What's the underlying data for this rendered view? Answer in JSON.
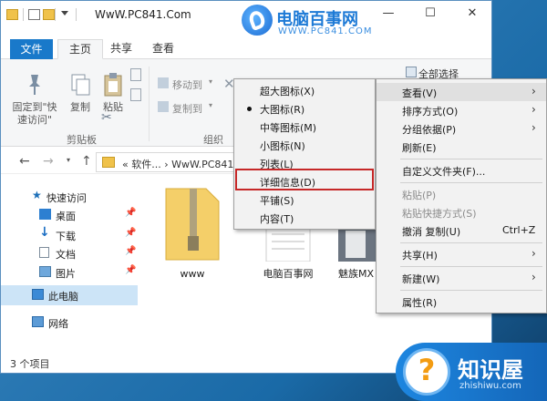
{
  "window": {
    "title": "WwW.PC841.Com",
    "controls": {
      "minimize": "—",
      "maximize": "☐",
      "close": "✕"
    }
  },
  "watermark_logo": {
    "title": "电脑百事网",
    "url": "WWW.PC841.COM"
  },
  "ribbon_tabs": {
    "file": "文件",
    "home": "主页",
    "share": "共享",
    "view": "查看"
  },
  "ribbon": {
    "pin_label": "固定到\"快\n速访问\"",
    "copy_label": "复制",
    "paste_label": "粘贴",
    "move_to": "移动到",
    "copy_to": "复制到",
    "clipboard_group": "剪贴板",
    "organize_group": "组织",
    "select_all": "全部选择"
  },
  "address": {
    "path": "«  软件...  ›  WwW.PC841 ›",
    "back": "←",
    "forward": "→",
    "up": "↑"
  },
  "nav": {
    "quick_access": "快速访问",
    "desktop": "桌面",
    "downloads": "下载",
    "documents": "文档",
    "pictures": "图片",
    "this_pc": "此电脑",
    "network": "网络",
    "pin": "📌"
  },
  "files": [
    {
      "name": "www"
    },
    {
      "name": "电脑百事网"
    },
    {
      "name": "魅族MX"
    }
  ],
  "status": {
    "count": "3 个项目"
  },
  "view_submenu": [
    {
      "label": "超大图标(X)"
    },
    {
      "label": "大图标(R)",
      "selected": true
    },
    {
      "label": "中等图标(M)"
    },
    {
      "label": "小图标(N)"
    },
    {
      "label": "列表(L)"
    },
    {
      "label": "详细信息(D)",
      "highlighted": true
    },
    {
      "label": "平铺(S)"
    },
    {
      "label": "内容(T)"
    }
  ],
  "context_menu": {
    "view": "查看(V)",
    "sort_by": "排序方式(O)",
    "group_by": "分组依据(P)",
    "refresh": "刷新(E)",
    "customize_folder": "自定义文件夹(F)...",
    "paste": "粘贴(P)",
    "paste_shortcut": "粘贴快捷方式(S)",
    "undo_copy": "撤消 复制(U)",
    "undo_shortcut": "Ctrl+Z",
    "share": "共享(H)",
    "new": "新建(W)",
    "properties": "属性(R)",
    "arrow": "›"
  },
  "site_badge": {
    "title": "知识屋",
    "url": "zhishiwu.com",
    "glyph": "?"
  },
  "colors": {
    "file_tab": "#1979ca",
    "highlight_box": "#c62828",
    "badge": "#1d86e0"
  }
}
